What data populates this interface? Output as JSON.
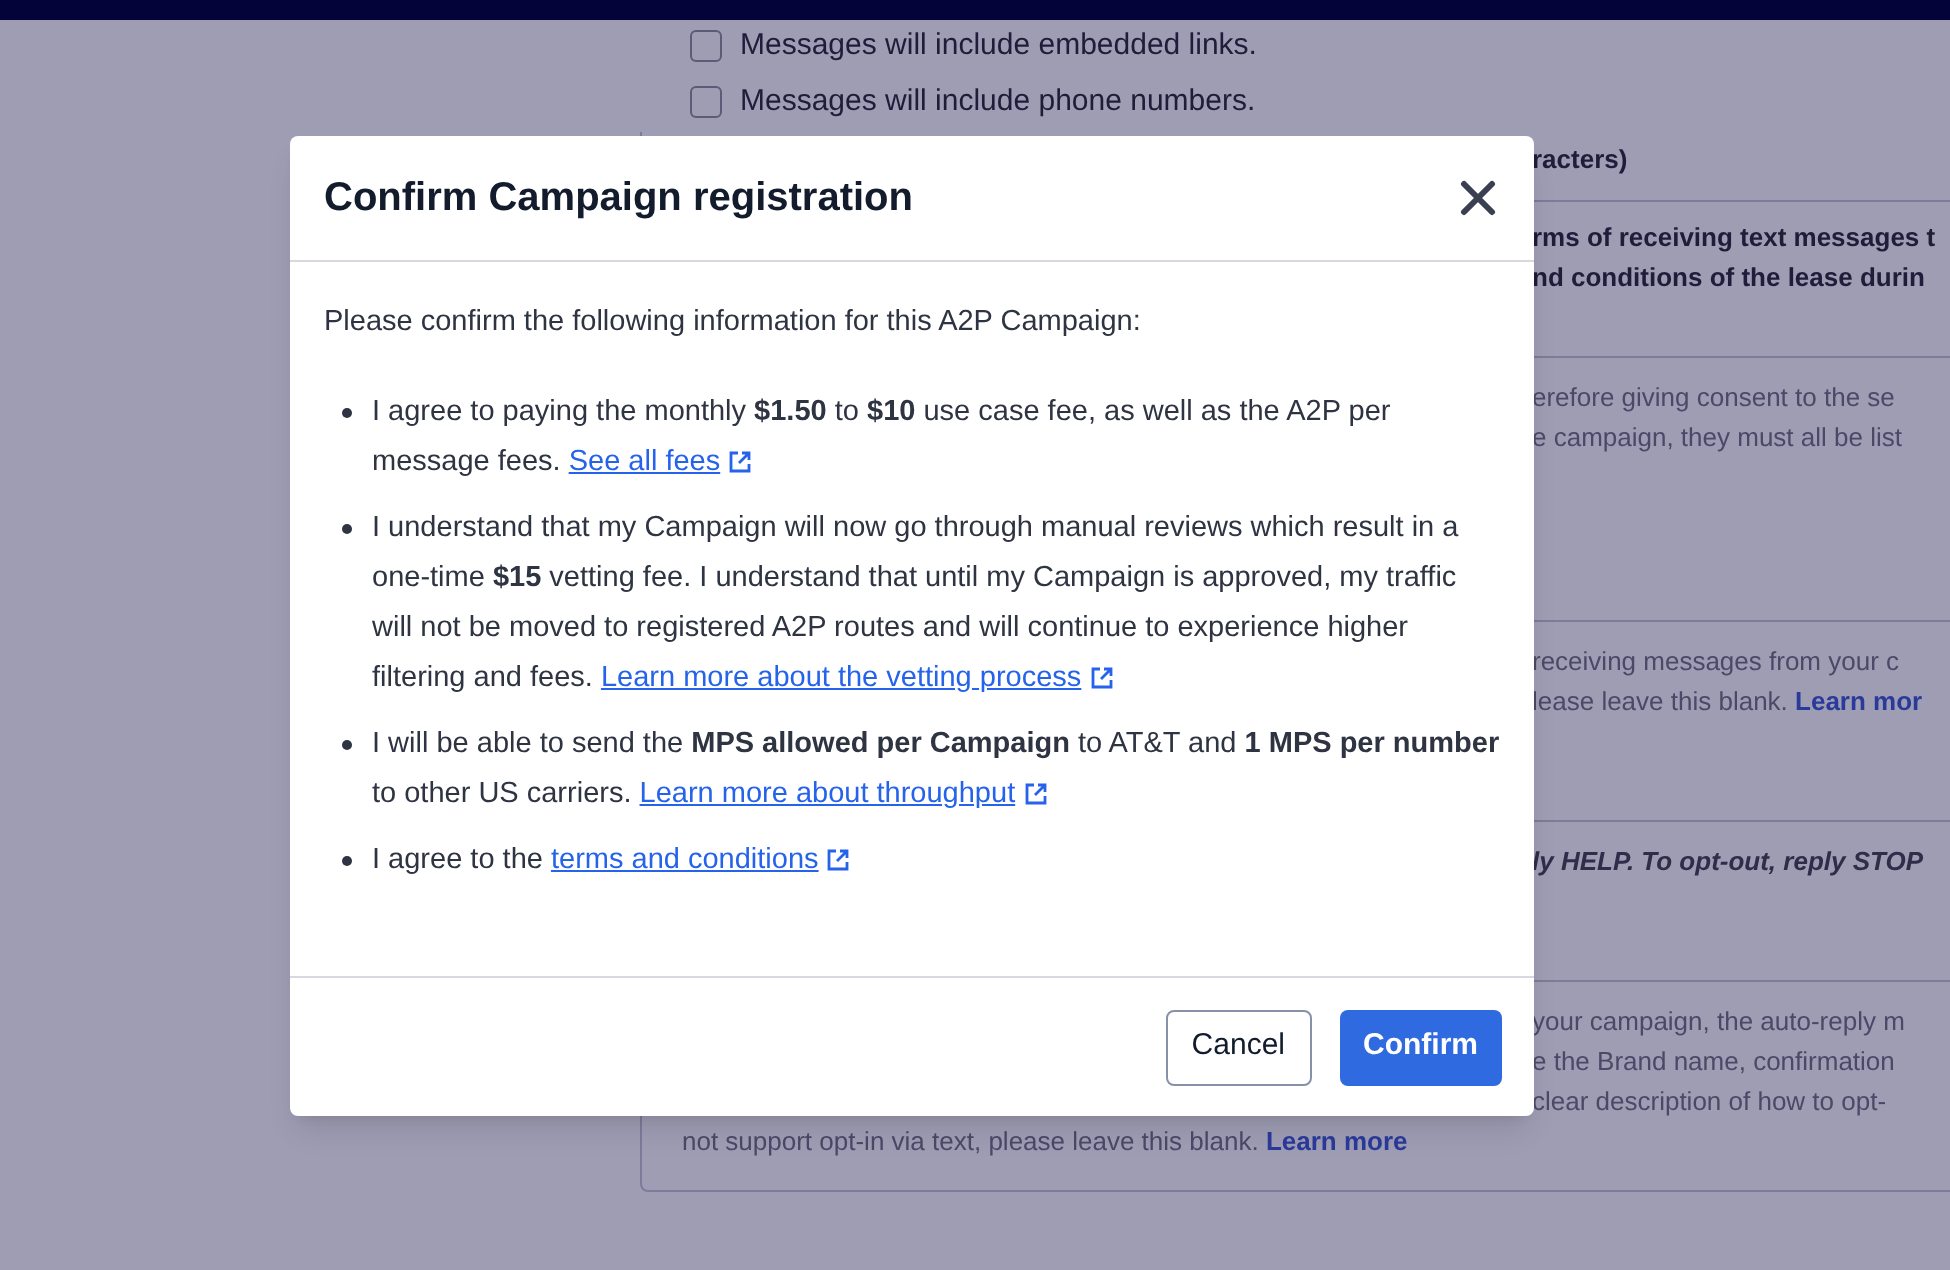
{
  "background": {
    "checkboxes": [
      {
        "label": "Messages will include embedded links.",
        "checked": false
      },
      {
        "label": "Messages will include phone numbers.",
        "checked": false
      }
    ],
    "fragments": [
      {
        "kind": "heading",
        "lines": [
          {
            "text": "racters)"
          }
        ]
      },
      {
        "kind": "value",
        "lines": [
          {
            "text": "rms of receiving text messages t"
          },
          {
            "text": "nd conditions of the lease durin"
          }
        ]
      },
      {
        "kind": "help",
        "lines": [
          {
            "text": "erefore giving consent to the se"
          },
          {
            "text": "e campaign, they must all be list"
          }
        ]
      },
      {
        "kind": "help",
        "lines": [
          {
            "text": "receiving messages from your c"
          },
          {
            "text": "lease leave this blank. ",
            "link": "Learn mor"
          }
        ]
      },
      {
        "kind": "example",
        "lines": [
          {
            "text": "ly HELP. To opt-out, reply STOP"
          }
        ]
      },
      {
        "kind": "help",
        "lines": [
          {
            "text": "your campaign, the auto-reply m"
          },
          {
            "text": "e the Brand name, confirmation"
          },
          {
            "text": "clear description of how to opt-"
          }
        ]
      }
    ],
    "footer_line": {
      "text": "not support opt-in via text, please leave this blank. ",
      "link": "Learn more"
    }
  },
  "modal": {
    "title": "Confirm Campaign registration",
    "intro": "Please confirm the following information for this A2P Campaign:",
    "items": [
      {
        "text": "I agree to paying the monthly **$1.50** to **$10** use case fee, as well as the A2P per message fees. ",
        "link": "See all fees"
      },
      {
        "text": "I understand that my Campaign will now go through manual reviews which result in a one-time **$15** vetting fee. I understand that until my Campaign is approved, my traffic will not be moved to registered A2P routes and will continue to experience higher filtering and fees. ",
        "link": "Learn more about the vetting process"
      },
      {
        "text": "I will be able to send the **MPS allowed per Campaign** to AT&T and **1 MPS per number** to other US carriers. ",
        "link": "Learn more about throughput"
      },
      {
        "text": "I agree to the ",
        "link": "terms and conditions"
      }
    ],
    "buttons": [
      {
        "label": "Cancel",
        "kind": "secondary"
      },
      {
        "label": "Confirm",
        "kind": "primary"
      }
    ]
  }
}
